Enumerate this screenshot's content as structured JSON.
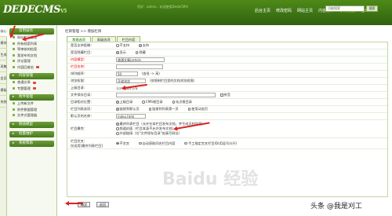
{
  "header": {
    "logo": "DEDECMS",
    "logo_sub": "V5",
    "info": "您好：admin，欢迎使用DedeCMS！",
    "nav": [
      "后台主页",
      "修改密码",
      "网站主页",
      "内容发布",
      "系统设置",
      "退出"
    ],
    "nav_active_index": 4,
    "search_placeholder": "功能搜索",
    "search_button": "搜索"
  },
  "vtabs": [
    "核心",
    "模块",
    "生成",
    "采集",
    "会员",
    "模板",
    "系统"
  ],
  "sidebar": {
    "sec1": "常用操作",
    "items1": [
      "网站栏目管理",
      "所有档案列表",
      "等审核的档案",
      "我发布的文档",
      "评论管理",
      "内容回收站"
    ],
    "sec2": "内容管理",
    "items2": [
      "普通文章",
      "专题管理"
    ],
    "sec3": "附件管理",
    "items3": [
      "上传新文件",
      "附件数据管理",
      "文件式管理器"
    ],
    "sec4": "频道模型",
    "sec5": "批量维护",
    "sec6": "系统帮助"
  },
  "breadcrumb": "栏目管理 >> 增加栏目",
  "tabs": [
    "常规选项",
    "高级选项",
    "栏目内容"
  ],
  "form": {
    "r1": {
      "label": "是否支持投稿：",
      "opts": [
        "不支持",
        "支持"
      ]
    },
    "r2": {
      "label": "是否隐藏栏目：",
      "opts": [
        "显示",
        "隐藏"
      ]
    },
    "r3": {
      "label": "内容模型：",
      "value": "普通文章|article"
    },
    "r4": {
      "label": "栏目名称："
    },
    "r5": {
      "label": "排列顺序：",
      "value": "50",
      "hint": "（由低 -> 高）"
    },
    "r6": {
      "label": "浏览权限：",
      "value": "开放浏览",
      "hint": "（仅限制栏目里的文档浏览权限）"
    },
    "r7": {
      "label": "上级目录：",
      "value": "{cmspath}/a"
    },
    "r8": {
      "label": "文件保存目录：",
      "check": "拼音"
    },
    "r9": {
      "label": "目录相对位置：",
      "opts": [
        "上级目录",
        "CMS根目录",
        "站点根目录"
      ]
    },
    "r10": {
      "label": "栏目列表选项：",
      "opts": [
        "链接到默认页",
        "链接到列表第一页",
        "使用动态页"
      ]
    },
    "r11": {
      "label": "默认页的名称：",
      "value": "index.html"
    },
    "r12": {
      "label": "栏目属性：",
      "opts": [
        "最终列表栏目（允许在本栏目发布文档，并生成文档列表）",
        "频道封面（栏目本身不允许发布文档）",
        "外部链接（在\"文件保存目录\"处填写网址）"
      ]
    },
    "r13": {
      "label": "栏目交叉：",
      "label2": "仅适用[最终列表栏目]",
      "opts": [
        "不交叉",
        "自动获取同名栏目内容",
        "手工指定交叉栏目ID(用逗号分开)"
      ]
    }
  },
  "buttons": {
    "ok": "确定",
    "back": "返回"
  },
  "watermark": "Baidu 经验",
  "watermark2": "头条 @我是刈工"
}
